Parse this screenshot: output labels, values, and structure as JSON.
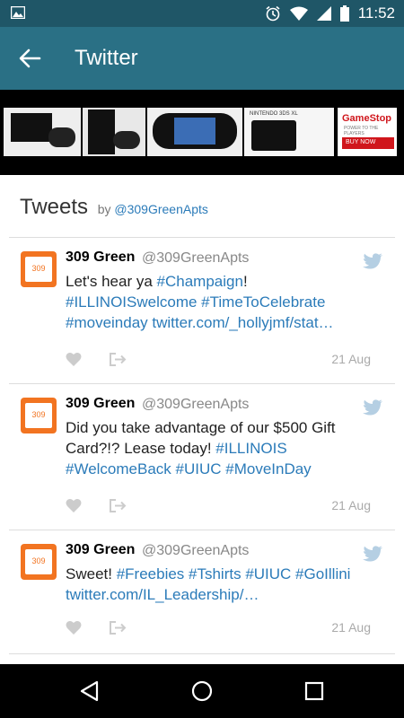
{
  "status": {
    "time": "11:52",
    "icons": [
      "image-icon",
      "alarm-icon",
      "wifi-icon",
      "signal-icon",
      "battery-icon"
    ]
  },
  "appbar": {
    "title": "Twitter",
    "back_icon": "arrow-back-icon"
  },
  "ad": {
    "brand": "GameStop",
    "tagline": "POWER TO THE PLAYERS",
    "cta": "BUY NOW",
    "device_label": "NINTENDO 3DS XL"
  },
  "timeline": {
    "heading": "Tweets",
    "by": "by",
    "by_handle": "@309GreenApts"
  },
  "tweets": [
    {
      "name": "309 Green",
      "handle": "@309GreenApts",
      "avatar_text": "309",
      "line1_prefix": "Let's hear ya ",
      "line1_tag": "#Champaign",
      "line1_suffix": "!",
      "line2": "#ILLINOISwelcome #TimeToCelebrate",
      "line3": "#moveinday  twitter.com/_hollyjmf/stat…",
      "date": "21 Aug"
    },
    {
      "name": "309 Green",
      "handle": "@309GreenApts",
      "avatar_text": "309",
      "line1": "Did you take advantage of our $500 Gift",
      "line2_prefix": "Card?!? Lease today! ",
      "line2_tag": "#ILLINOIS",
      "line3": "#WelcomeBack #UIUC #MoveInDay",
      "date": "21 Aug"
    },
    {
      "name": "309 Green",
      "handle": "@309GreenApts",
      "avatar_text": "309",
      "line1_prefix": "Sweet! ",
      "line1_tags": "#Freebies #Tshirts #UIUC #GoIllini",
      "line2": "twitter.com/IL_Leadership/…",
      "date": "21 Aug"
    }
  ],
  "colors": {
    "statusbar": "#1f5667",
    "appbar": "#2a7085",
    "link": "#2b7bb9",
    "avatar": "#f27421",
    "gamestop": "#d0161c"
  }
}
